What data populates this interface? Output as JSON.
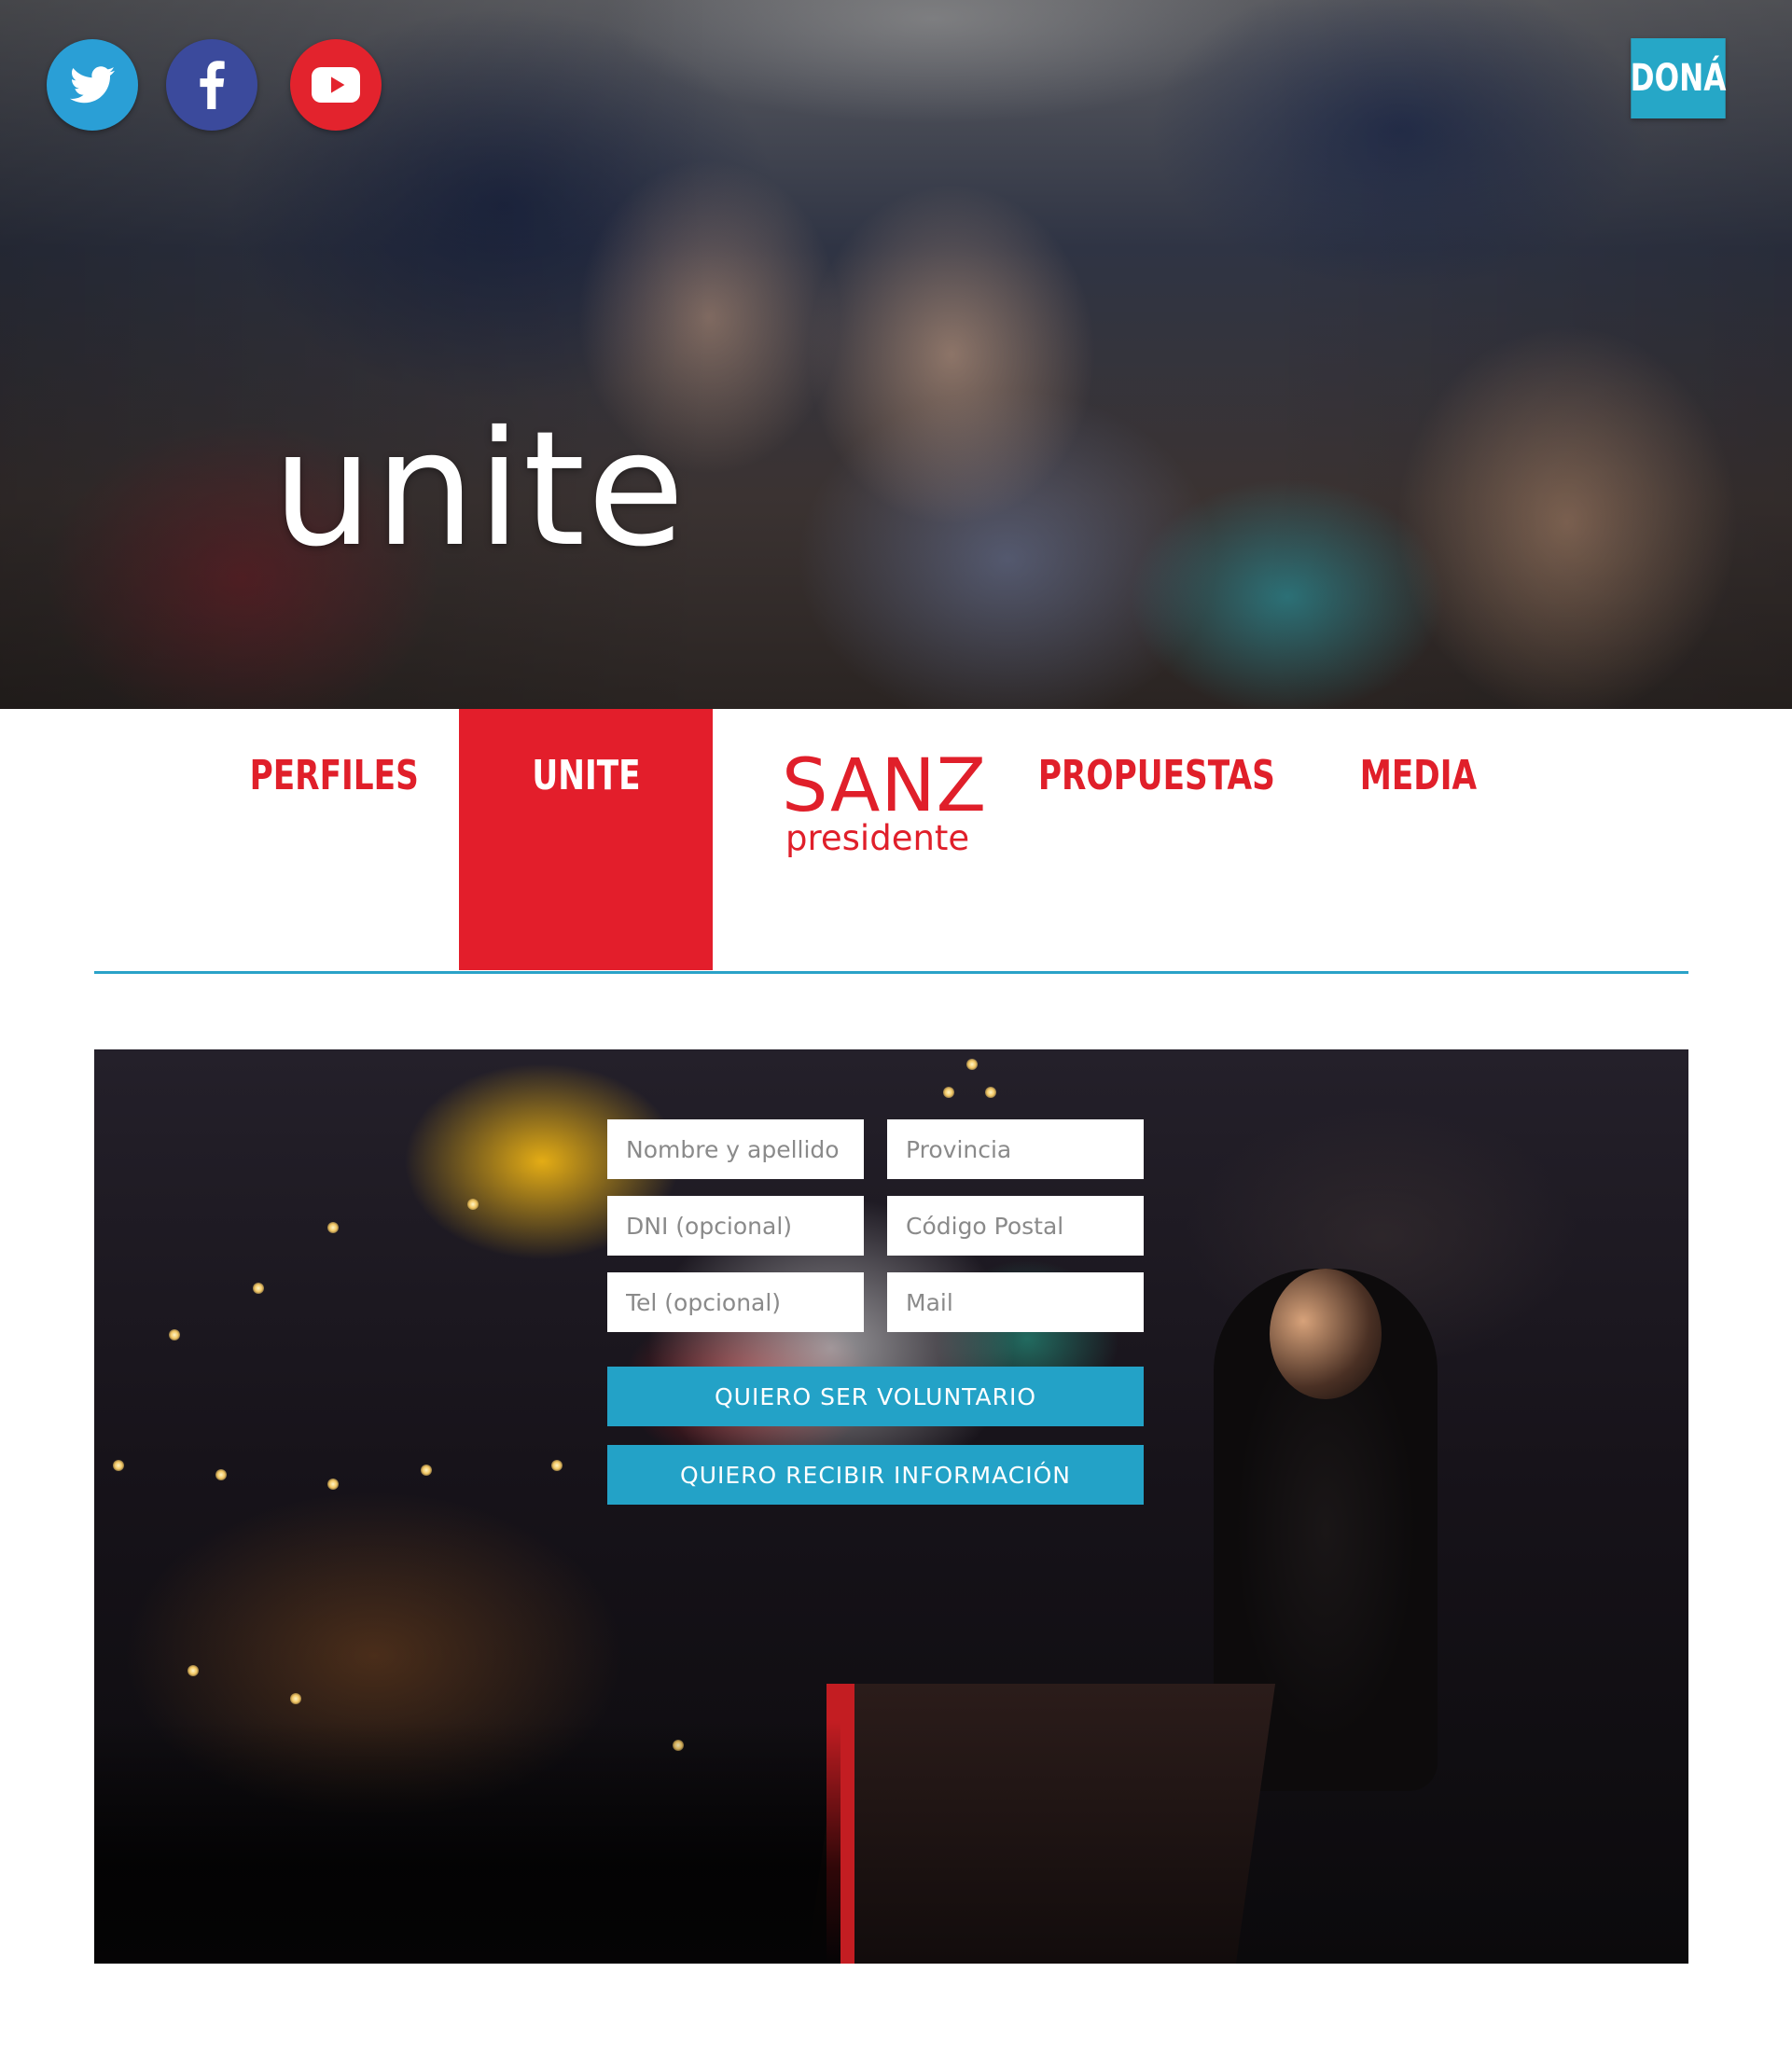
{
  "header": {
    "title": "unite",
    "donate_label": "DONÁ",
    "social": [
      "twitter-icon",
      "facebook-icon",
      "youtube-icon"
    ]
  },
  "nav": {
    "items": [
      {
        "label": "PERFILES",
        "active": false
      },
      {
        "label": "UNITE",
        "active": true
      },
      {
        "label": "PROPUESTAS",
        "active": false
      },
      {
        "label": "MEDIA",
        "active": false
      }
    ],
    "logo": {
      "main": "SANZ",
      "sub": "presidente"
    }
  },
  "form": {
    "fields": [
      {
        "placeholder": "Nombre y apellido"
      },
      {
        "placeholder": "Provincia"
      },
      {
        "placeholder": "DNI (opcional)"
      },
      {
        "placeholder": "Código Postal"
      },
      {
        "placeholder": "Tel (opcional)"
      },
      {
        "placeholder": "Mail"
      }
    ],
    "volunteer_label": "QUIERO SER VOLUNTARIO",
    "info_label": "QUIERO RECIBIR INFORMACIÓN"
  },
  "colors": {
    "brand_red": "#e31e2b",
    "accent_blue": "#23a2c7",
    "twitter_blue": "#2a9fd6",
    "facebook_blue": "#3b4a9c",
    "youtube_red": "#e3232d"
  }
}
